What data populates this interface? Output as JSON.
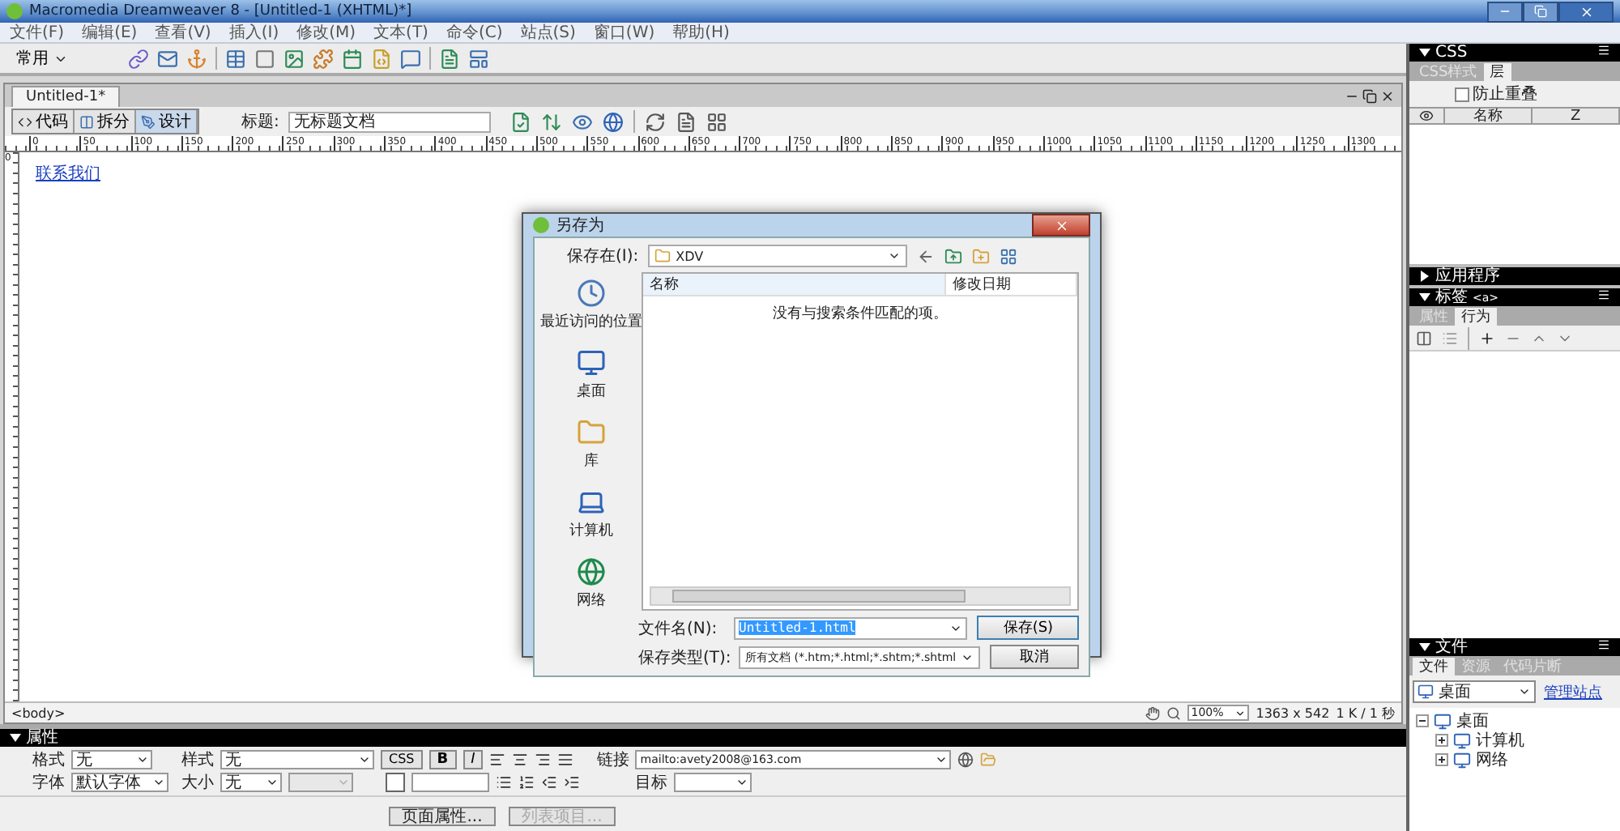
{
  "window": {
    "title": "Macromedia Dreamweaver 8 - [Untitled-1 (XHTML)*]"
  },
  "menu": [
    "文件(F)",
    "编辑(E)",
    "查看(V)",
    "插入(I)",
    "修改(M)",
    "文本(T)",
    "命令(C)",
    "站点(S)",
    "窗口(W)",
    "帮助(H)"
  ],
  "insert_bar": {
    "category": "常用"
  },
  "document": {
    "tab": "Untitled-1*",
    "view_buttons": [
      {
        "label": "代码",
        "selected": false
      },
      {
        "label": "拆分",
        "selected": false
      },
      {
        "label": "设计",
        "selected": true
      }
    ],
    "title_label": "标题:",
    "title_value": "无标题文档",
    "ruler_ticks": [
      "0",
      "50",
      "100",
      "150",
      "200",
      "250",
      "300",
      "350",
      "400",
      "450",
      "500",
      "550",
      "600",
      "650",
      "700",
      "750",
      "800",
      "850",
      "900",
      "950",
      "1000",
      "1050",
      "1100",
      "1150",
      "1200",
      "1250",
      "1300"
    ],
    "vertical_ruler_tick": "0",
    "link": "联系我们"
  },
  "status_bar": {
    "tag": "<body>",
    "zoom": "100%",
    "size": "1363 x 542",
    "download": "1 K / 1 秒"
  },
  "properties": {
    "title": "属性",
    "expanded": true,
    "format": {
      "label": "格式",
      "value": "无"
    },
    "style": {
      "label": "样式",
      "value": "无"
    },
    "css_button": "CSS",
    "bold": "B",
    "italic": "I",
    "link": {
      "label": "链接",
      "value": "mailto:avety2008@163.com"
    },
    "font": {
      "label": "字体",
      "value": "默认字体"
    },
    "size": {
      "label": "大小",
      "value": "无"
    },
    "target": {
      "label": "目标"
    },
    "buttons": [
      {
        "label": "页面属性...",
        "disabled": false
      },
      {
        "label": "列表项目...",
        "disabled": true
      }
    ]
  },
  "panels": {
    "css": {
      "title": "CSS",
      "expanded": true,
      "tabs": [
        {
          "label": "CSS样式",
          "selected": false
        },
        {
          "label": "层",
          "selected": true
        }
      ],
      "prevent_overlap": {
        "label": "防止重叠",
        "checked": false
      },
      "columns": [
        "名称",
        "Z"
      ]
    },
    "application": {
      "title": "应用程序",
      "expanded": false
    },
    "tag": {
      "title": "标签",
      "tag": "<a>",
      "expanded": true,
      "tabs": [
        {
          "label": "属性",
          "selected": false
        },
        {
          "label": "行为",
          "selected": true
        }
      ]
    },
    "files": {
      "title": "文件",
      "expanded": true,
      "tabs": [
        {
          "label": "文件",
          "selected": true
        },
        {
          "label": "资源",
          "selected": false
        },
        {
          "label": "代码片断",
          "selected": false
        }
      ],
      "site": "桌面",
      "manage": "管理站点",
      "tree": [
        {
          "label": "桌面",
          "expanded": true,
          "children": [
            {
              "label": "计算机",
              "expanded": false
            },
            {
              "label": "网络",
              "expanded": false
            }
          ]
        }
      ]
    }
  },
  "dialog": {
    "title": "另存为",
    "save_in_label": "保存在(I):",
    "folder": "XDV",
    "places": [
      {
        "label": "最近访问的位置",
        "kind": "recent"
      },
      {
        "label": "桌面",
        "kind": "desktop"
      },
      {
        "label": "库",
        "kind": "library"
      },
      {
        "label": "计算机",
        "kind": "computer"
      },
      {
        "label": "网络",
        "kind": "network"
      }
    ],
    "columns": [
      "名称",
      "修改日期"
    ],
    "empty_message": "没有与搜索条件匹配的项。",
    "file_name_label": "文件名(N):",
    "file_name": "Untitled-1.html",
    "file_name_selected": true,
    "file_type_label": "保存类型(T):",
    "file_type": "所有文档 (*.htm;*.html;*.shtm;*.shtml",
    "buttons": [
      {
        "label": "保存(S)",
        "default": true
      },
      {
        "label": "取消",
        "default": false
      }
    ]
  }
}
